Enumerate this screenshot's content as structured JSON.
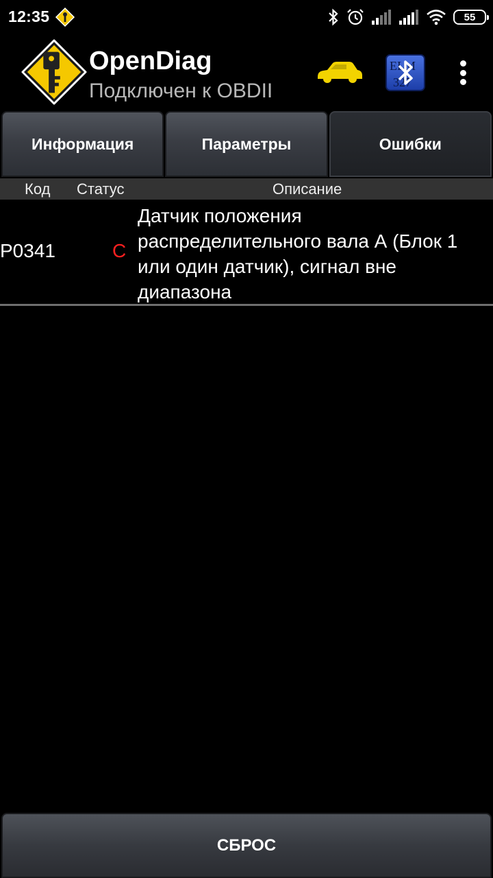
{
  "status_bar": {
    "time": "12:35",
    "battery": "55",
    "icons": [
      "notification-key-icon",
      "bluetooth-icon",
      "alarm-icon",
      "signal-icon",
      "signal-icon",
      "wifi-icon",
      "battery-icon"
    ]
  },
  "app_bar": {
    "title": "OpenDiag",
    "subtitle": "Подключен к OBDII",
    "icons": [
      "app-logo-icon",
      "car-icon",
      "bluetooth-adapter-icon",
      "overflow-menu-icon"
    ],
    "adapter_label": "ELM 327"
  },
  "tabs": [
    {
      "label": "Информация",
      "active": false
    },
    {
      "label": "Параметры",
      "active": false
    },
    {
      "label": "Ошибки",
      "active": true
    }
  ],
  "columns": {
    "code": "Код",
    "status": "Статус",
    "description": "Описание"
  },
  "errors": [
    {
      "code": "P0341",
      "status": "C",
      "description": "Датчик положения распределительного вала А (Блок 1 или один датчик), сигнал вне диапазона"
    }
  ],
  "reset_button": "СБРОС",
  "colors": {
    "background": "#000000",
    "status_error": "#ff2020",
    "car": "#f2d300",
    "logo": "#f5c800",
    "subtitle": "#b8b8b8"
  }
}
